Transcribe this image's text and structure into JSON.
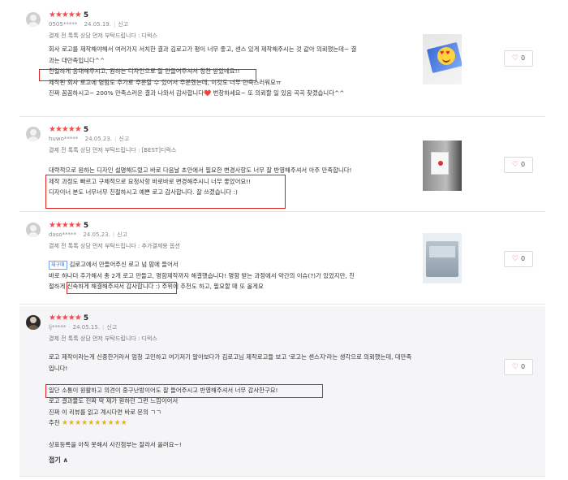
{
  "reviews": [
    {
      "stars": "★★★★★",
      "rating": "5",
      "user": "0505*****",
      "date": "24.05.19.",
      "report": "신고",
      "option": "결제 전 톡톡 상담 먼저 부탁드립니다 : 디럭스",
      "lines": [
        "회사 로고를 제작해야해서 여러가지 서치한 결과 김로고가 평이 너무 좋고, 센스 있게 제작해주시는 것 같아 의뢰했는데~ 결",
        "과는 대만족입니다^^",
        "친절하게 응대해주시고, 원하는 디자인으로 잘 만들어주셔서 칭찬 받았네요!!",
        "제작된 회사 로고에 명함도 추가로 주문할 수 있어서 주문했는데, 이것도 너무 만족스러워요ㅠ",
        "진짜 꼼꼼하시고~ 200% 만족스러운 결과 나와서 감사합니다❤️ 번창하세요~ 또 의뢰할 일 있음 곡곡 찾겠습니다^^"
      ],
      "likes": "0"
    },
    {
      "stars": "★★★★★",
      "rating": "5",
      "user": "huwo*****",
      "date": "24.05.23.",
      "report": "신고",
      "option": "결제 전 톡톡 상담 먼저 부탁드립니다 : [BEST]디럭스",
      "lines": [
        "대략적으로 원하는 디자인 설명해드렸고 바로 다음날 초안에서 필요한 변경사항도 너무 잘 반영해주셔서 아주 만족합니다!",
        "제작 과정도 빠르고 구체적으로 요청사항 바로바로 변경해주시니 너무 좋았어요!!",
        "디자이너 분도 너무너무 친절하시고 예쁜 로고 감사합니다. 잘 쓰겠습니다 :)"
      ],
      "likes": "0"
    },
    {
      "stars": "★★★★★",
      "rating": "5",
      "user": "daso*****",
      "date": "24.05.23.",
      "report": "신고",
      "option": "결제 전 톡톡 상담 먼저 부탁드립니다 : 추가결제용 옵션",
      "tag": "재구매",
      "lines": [
        "김로고에서 만들어주신 로고 넘 맘에 들어서",
        "바로 하나더 추가해서 총 2개 로고 만들고, 명함제작까지 해결했습니다! 명함 받는 과정에서 약간의 이슈(?)가 있었지만, 친",
        "절하게 신속하게 해결해주셔서 감사합니다 :) 주위에 추천도 하고, 필요할 때 또 올게요"
      ],
      "likes": "0"
    },
    {
      "stars": "★★★★★",
      "rating": "5",
      "user": "lj*****",
      "date": "24.05.15.",
      "report": "신고",
      "option": "결제 전 톡톡 상담 먼저 부탁드립니다 : 디럭스",
      "lines": [
        "로고 제작이라는게 신중한거라서 엄청 고민하고 여기저기 알아보다가 김로고님 제작로고들 보고 '로고는 센스지'라는 생각으로 의뢰했는데, 대만족",
        "입니다!",
        "",
        "일단 소통이 원활하고 의견이 중구난방이어도 잘 들어주시고 반영해주셔서 너무 감사한구요!",
        "로고 결과물도 진짜 딱 제가 원하던 그런 느낌이어서",
        "진짜 이 리뷰를 읽고 계시다면 바로 문의 ㄱㄱ",
        "추천 ⭐⭐⭐⭐⭐⭐⭐⭐⭐⭐",
        "",
        "상표등록을 아직 못해서 사진첨부는 잘라서 올려요~!"
      ],
      "recommend_label": "추천",
      "recommend_stars": "★★★★★★★★★★",
      "fold": "접기 ∧",
      "likes": "0"
    }
  ],
  "colors": {
    "star": "#f04e4e",
    "highlight_box": "#e0221e",
    "tag": "#3a78e0"
  },
  "icons": {
    "like": "heart-outline-icon"
  }
}
